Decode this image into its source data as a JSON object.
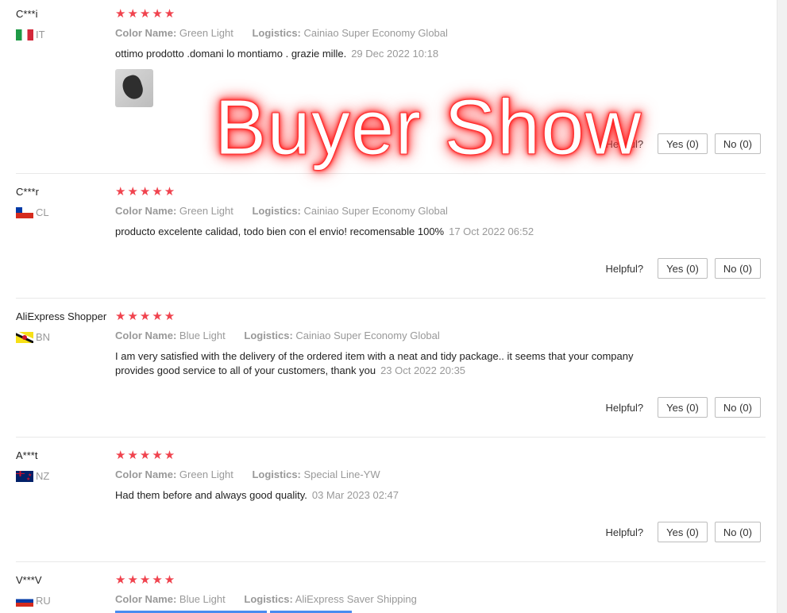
{
  "watermark": "Buyer Show",
  "reviews": [
    {
      "user": "C***i",
      "country": "IT",
      "stars": "★★★★★",
      "color_label": "Color Name:",
      "color_value": "Green Light",
      "logistics_label": "Logistics:",
      "logistics_value": "Cainiao Super Economy Global",
      "text": "ottimo prodotto .domani lo montiamo . grazie mille.",
      "date": "29 Dec 2022 10:18",
      "helpful_label": "Helpful?",
      "yes": "Yes (0)",
      "no": "No (0)"
    },
    {
      "user": "C***r",
      "country": "CL",
      "stars": "★★★★★",
      "color_label": "Color Name:",
      "color_value": "Green Light",
      "logistics_label": "Logistics:",
      "logistics_value": "Cainiao Super Economy Global",
      "text": "producto excelente calidad, todo bien con el envio! recomensable 100%",
      "date": "17 Oct 2022 06:52",
      "helpful_label": "Helpful?",
      "yes": "Yes (0)",
      "no": "No (0)"
    },
    {
      "user": "AliExpress Shopper",
      "country": "BN",
      "stars": "★★★★★",
      "color_label": "Color Name:",
      "color_value": "Blue Light",
      "logistics_label": "Logistics:",
      "logistics_value": "Cainiao Super Economy Global",
      "text": "I am very satisfied with the delivery of the ordered item with a neat and tidy package.. it seems that your company provides good service to all of your customers, thank you",
      "date": "23 Oct 2022 20:35",
      "helpful_label": "Helpful?",
      "yes": "Yes (0)",
      "no": "No (0)"
    },
    {
      "user": "A***t",
      "country": "NZ",
      "stars": "★★★★★",
      "color_label": "Color Name:",
      "color_value": "Green Light",
      "logistics_label": "Logistics:",
      "logistics_value": "Special Line-YW",
      "text": "Had them before and always good quality.",
      "date": "03 Mar 2023 02:47",
      "helpful_label": "Helpful?",
      "yes": "Yes (0)",
      "no": "No (0)"
    },
    {
      "user": "V***V",
      "country": "RU",
      "stars": "★★★★★",
      "color_label": "Color Name:",
      "color_value": "Blue Light",
      "logistics_label": "Logistics:",
      "logistics_value": "AliExpress Saver Shipping"
    }
  ]
}
